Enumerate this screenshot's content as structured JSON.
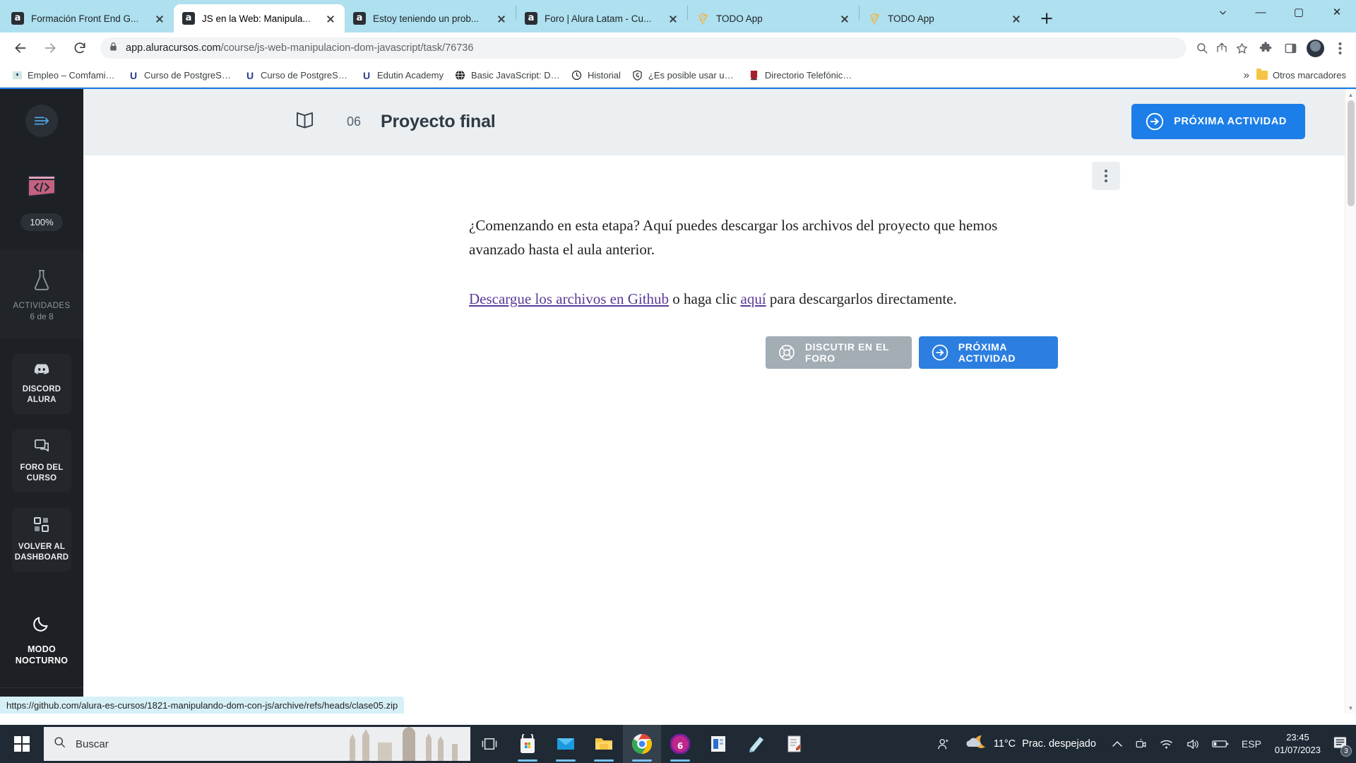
{
  "browser": {
    "tabs": [
      {
        "title": "Formación Front End G...",
        "icon": "alura-icon",
        "active": false
      },
      {
        "title": "JS en la Web: Manipula...",
        "icon": "alura-icon",
        "active": true
      },
      {
        "title": "Estoy teniendo un prob...",
        "icon": "alura-icon",
        "active": false
      },
      {
        "title": "Foro | Alura Latam - Cu...",
        "icon": "alura-icon",
        "active": false
      },
      {
        "title": "TODO App",
        "icon": "vite-icon",
        "active": false
      },
      {
        "title": "TODO App",
        "icon": "vite-icon",
        "active": false
      }
    ],
    "new_tab_label": "+",
    "window_controls": {
      "minimize": "—",
      "maximize": "▢",
      "close": "✕"
    },
    "toolbar": {
      "back": "←",
      "forward": "→",
      "reload": "⟳",
      "url_domain": "app.aluracursos.com",
      "url_path": "/course/js-web-manipulacion-dom-javascript/task/76736",
      "url_full": "app.aluracursos.com/course/js-web-manipulacion-dom-javascript/task/76736",
      "lock_icon": "lock-icon",
      "zoom_icon": "search-magnifier-icon",
      "share_icon": "share-icon",
      "bookmark_icon": "star-icon",
      "extensions_icon": "puzzle-icon",
      "sidepanel_icon": "side-panel-icon",
      "profile_icon": "avatar-icon",
      "menu_icon": "three-dot-menu-icon"
    },
    "bookmarks": [
      {
        "label": "Empleo – Comfamilia...",
        "icon": "shield-crest-icon"
      },
      {
        "label": "Curso de PostgreSQL",
        "icon": "udemy-u-icon"
      },
      {
        "label": "Curso de PostgreSQL...",
        "icon": "udemy-u-icon"
      },
      {
        "label": "Edutin Academy",
        "icon": "udemy-u-icon"
      },
      {
        "label": "Basic JavaScript: Decl...",
        "icon": "globe-icon"
      },
      {
        "label": "Historial",
        "icon": "history-clock-icon"
      },
      {
        "label": "¿Es posible usar un e...",
        "icon": "alura-shield-icon"
      },
      {
        "label": "Directorio Telefónico...",
        "icon": "crest-icon"
      }
    ],
    "bookmarks_overflow": "»",
    "other_bookmarks": "Otros marcadores",
    "status_url": "https://github.com/alura-es-cursos/1821-manipulando-dom-con-js/archive/refs/heads/clase05.zip"
  },
  "alura": {
    "sidebar": {
      "toggle_icon": "menu-arrow-icon",
      "progress": {
        "icon": "code-window-icon",
        "percent": "100%"
      },
      "activities": {
        "icon": "flask-icon",
        "label": "ACTIVIDADES",
        "count": "6 de 8"
      },
      "links": [
        {
          "label": "DISCORD ALURA",
          "icon": "discord-icon"
        },
        {
          "label": "FORO DEL CURSO",
          "icon": "chat-bubble-icon"
        },
        {
          "label": "VOLVER AL DASHBOARD",
          "icon": "grid-squares-icon"
        }
      ],
      "night_mode": {
        "label": "MODO NOCTURNO",
        "icon": "moon-icon"
      }
    },
    "task_header": {
      "book_icon": "open-book-icon",
      "number": "06",
      "title": "Proyecto final",
      "cta_label": "PRÓXIMA ACTIVIDAD",
      "cta_icon": "arrow-right-circle-icon"
    },
    "options_menu_icon": "vertical-dots-icon",
    "content": {
      "paragraph1": "¿Comenzando en esta etapa? Aquí puedes descargar los archivos del proyecto que hemos avanzado hasta el aula anterior.",
      "p2_link1": "Descargue los archivos en Github",
      "p2_mid": " o haga clic ",
      "p2_link2": "aquí",
      "p2_end": " para descargarlos directamente."
    },
    "buttons": {
      "forum": {
        "label": "DISCUTIR EN EL FORO",
        "icon": "lifebuoy-icon",
        "color": "#a2adb4"
      },
      "next": {
        "label": "PRÓXIMA ACTIVIDAD",
        "icon": "arrow-right-circle-icon",
        "color": "#2c7fe0"
      }
    }
  },
  "taskbar": {
    "start_icon": "windows-logo-icon",
    "search_placeholder": "Buscar",
    "search_icon": "magnifier-icon",
    "apps": [
      {
        "name": "task-view-icon"
      },
      {
        "name": "microsoft-store-icon"
      },
      {
        "name": "mail-icon"
      },
      {
        "name": "file-explorer-icon"
      },
      {
        "name": "google-chrome-icon"
      },
      {
        "name": "opera-gx-icon"
      },
      {
        "name": "office-app-icon"
      },
      {
        "name": "notes-app-icon"
      },
      {
        "name": "editor-app-icon"
      }
    ],
    "tray": {
      "people_icon": "people-icon",
      "weather_icon": "moon-cloud-icon",
      "temperature": "11°C",
      "weather_text": "Prac. despejado",
      "chevron": "⌃",
      "icons": [
        "camera-icon",
        "wifi-icon",
        "volume-icon",
        "battery-icon"
      ],
      "language": "ESP",
      "time": "23:45",
      "date": "01/07/2023",
      "notification_icon": "notification-icon",
      "notification_count": "3"
    }
  }
}
